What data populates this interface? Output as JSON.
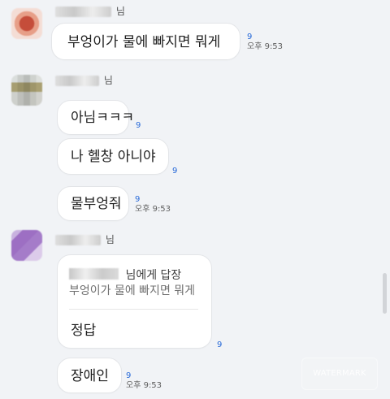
{
  "messages": [
    {
      "sender_suffix": "님",
      "text": "부엉이가 물에 빠지면 뭐게",
      "count": "9",
      "time": "오후 9:53"
    },
    {
      "sender_suffix": "님",
      "text": "아님ㅋㅋㅋ",
      "count": "9"
    },
    {
      "text": "나 헬창 아니야",
      "count": "9"
    },
    {
      "text": "물부엉줘",
      "count": "9",
      "time": "오후 9:53"
    },
    {
      "sender_suffix": "님",
      "reply_header": "님에게 답장",
      "reply_quote": "부엉이가 물에 빠지면 뭐게",
      "text": "정답",
      "count": "9"
    },
    {
      "text": "장애인",
      "count": "9",
      "time": "오후 9:53"
    }
  ],
  "watermark": "WATERMARK",
  "colors": {
    "background": "#f1f3f6",
    "bubble": "#ffffff",
    "unread_count": "#2769d8"
  }
}
